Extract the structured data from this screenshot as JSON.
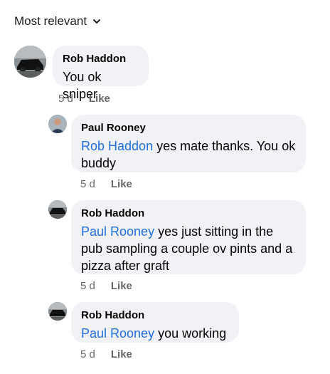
{
  "sort": {
    "label": "Most relevant",
    "icon": "chevron-down-icon"
  },
  "comments": [
    {
      "author": "Rob Haddon",
      "mention": "",
      "text": "You ok sniper",
      "time": "5 d",
      "like_label": "Like"
    },
    {
      "author": "Paul Rooney",
      "mention": "Rob Haddon",
      "text": " yes mate thanks. You ok buddy",
      "time": "5 d",
      "like_label": "Like"
    },
    {
      "author": "Rob Haddon",
      "mention": "Paul Rooney",
      "text": " yes just sitting in the pub sampling a couple ov pints and a pizza after graft",
      "time": "5 d",
      "like_label": "Like"
    },
    {
      "author": "Rob Haddon",
      "mention": "Paul Rooney",
      "text": " you working",
      "time": "5 d",
      "like_label": "Like"
    }
  ],
  "colors": {
    "bubble": "#f0f2f5",
    "mention": "#216fdb",
    "meta": "#65676b"
  }
}
